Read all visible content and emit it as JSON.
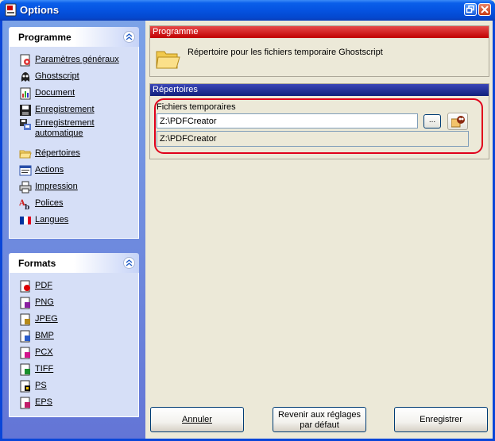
{
  "window": {
    "title": "Options"
  },
  "sidebar": {
    "groups": [
      {
        "title": "Programme",
        "items": [
          {
            "label": "Paramètres généraux",
            "icon": "settings-icon"
          },
          {
            "label": "Ghostscript",
            "icon": "ghostscript-icon"
          },
          {
            "label": "Document",
            "icon": "document-icon"
          },
          {
            "label": "Enregistrement",
            "icon": "save-icon"
          },
          {
            "label": "Enregistrement automatique",
            "icon": "auto-save-icon"
          },
          {
            "label": "Répertoires",
            "icon": "folder-icon"
          },
          {
            "label": "Actions",
            "icon": "actions-icon"
          },
          {
            "label": "Impression",
            "icon": "printer-icon"
          },
          {
            "label": "Polices",
            "icon": "fonts-icon"
          },
          {
            "label": "Langues",
            "icon": "flag-icon"
          }
        ]
      },
      {
        "title": "Formats",
        "items": [
          {
            "label": "PDF",
            "icon": "pdf-file-icon"
          },
          {
            "label": "PNG",
            "icon": "png-file-icon"
          },
          {
            "label": "JPEG",
            "icon": "jpeg-file-icon"
          },
          {
            "label": "BMP",
            "icon": "bmp-file-icon"
          },
          {
            "label": "PCX",
            "icon": "pcx-file-icon"
          },
          {
            "label": "TIFF",
            "icon": "tiff-file-icon"
          },
          {
            "label": "PS",
            "icon": "ps-file-icon"
          },
          {
            "label": "EPS",
            "icon": "eps-file-icon"
          }
        ]
      }
    ]
  },
  "main": {
    "programme_panel": {
      "header": "Programme",
      "description": "Répertoire pour les fichiers temporaire Ghostscript"
    },
    "directories_panel": {
      "header": "Répertoires",
      "temp_label": "Fichiers temporaires",
      "temp_value": "Z:\\PDFCreator",
      "temp_resolved": "Z:\\PDFCreator",
      "browse_label": "..."
    }
  },
  "buttons": {
    "cancel": "Annuler",
    "default_line1": "Revenir aux réglages",
    "default_line2": "par défaut",
    "save": "Enregistrer"
  },
  "colors": {
    "titlebar": "#0553e1",
    "programme_header": "#c10000",
    "directories_header": "#10207c",
    "highlight": "#e0001b"
  }
}
